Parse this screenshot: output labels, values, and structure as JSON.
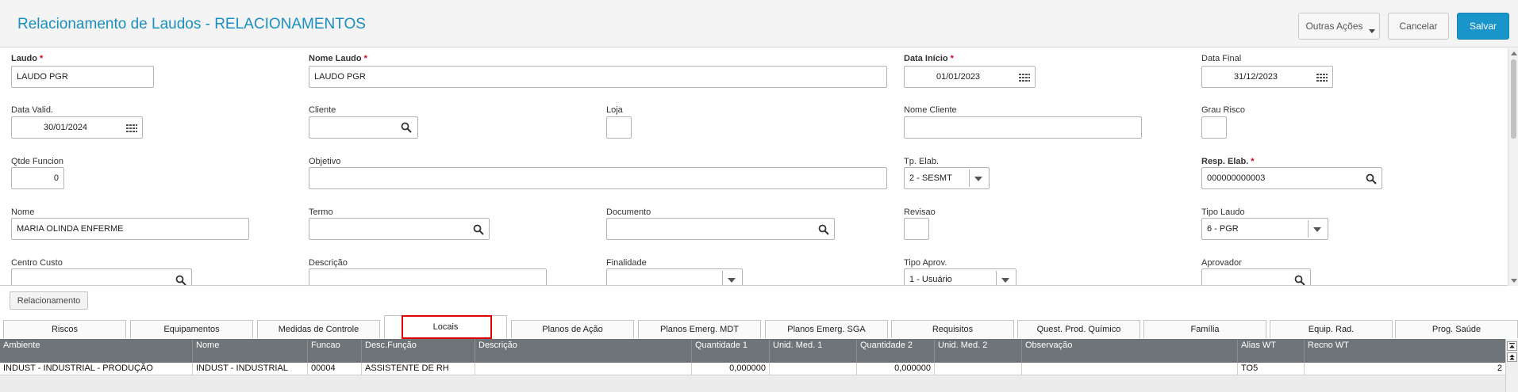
{
  "header": {
    "title": "Relacionamento de Laudos - RELACIONAMENTOS",
    "other_actions": "Outras Ações",
    "cancel": "Cancelar",
    "save": "Salvar"
  },
  "form": {
    "laudo": {
      "label": "Laudo",
      "value": "LAUDO PGR"
    },
    "nome_laudo": {
      "label": "Nome Laudo",
      "value": "LAUDO PGR"
    },
    "data_inicio": {
      "label": "Data Início",
      "value": "01/01/2023"
    },
    "data_final": {
      "label": "Data Final",
      "value": "31/12/2023"
    },
    "data_valid": {
      "label": "Data Valid.",
      "value": "30/01/2024"
    },
    "cliente": {
      "label": "Cliente",
      "value": ""
    },
    "loja": {
      "label": "Loja",
      "value": ""
    },
    "nome_cliente": {
      "label": "Nome Cliente",
      "value": ""
    },
    "grau_risco": {
      "label": "Grau Risco",
      "value": ""
    },
    "qtde_funcion": {
      "label": "Qtde Funcion",
      "value": "0"
    },
    "objetivo": {
      "label": "Objetivo",
      "value": ""
    },
    "tp_elab": {
      "label": "Tp. Elab.",
      "value": "2 - SESMT"
    },
    "resp_elab": {
      "label": "Resp. Elab.",
      "value": "000000000003"
    },
    "nome": {
      "label": "Nome",
      "value": "MARIA OLINDA ENFERME"
    },
    "termo": {
      "label": "Termo",
      "value": ""
    },
    "documento": {
      "label": "Documento",
      "value": ""
    },
    "revisao": {
      "label": "Revisao",
      "value": ""
    },
    "tipo_laudo": {
      "label": "Tipo Laudo",
      "value": "6 - PGR"
    },
    "centro_custo": {
      "label": "Centro Custo",
      "value": ""
    },
    "descricao": {
      "label": "Descrição",
      "value": ""
    },
    "finalidade": {
      "label": "Finalidade",
      "value": ""
    },
    "tipo_aprov": {
      "label": "Tipo Aprov.",
      "value": "1 - Usuário"
    },
    "aprovador": {
      "label": "Aprovador",
      "value": ""
    }
  },
  "relacionamento_button": "Relacionamento",
  "tabs": [
    "Riscos",
    "Equipamentos",
    "Medidas de Controle",
    "Locais",
    "Planos de Ação",
    "Planos Emerg. MDT",
    "Planos Emerg. SGA",
    "Requisitos",
    "Quest. Prod. Químico",
    "Família",
    "Equip. Rad.",
    "Prog. Saúde"
  ],
  "active_tab": "Locais",
  "grid": {
    "columns": [
      "Ambiente",
      "Nome",
      "Funcao",
      "Desc.Função",
      "Descrição",
      "Quantidade 1",
      "Unid. Med. 1",
      "Quantidade 2",
      "Unid. Med. 2",
      "Observação",
      "Alias WT",
      "Recno WT"
    ],
    "rows": [
      [
        "INDUST - INDUSTRIAL - PRODUÇÃO",
        "INDUST - INDUSTRIAL",
        "00004",
        "ASSISTENTE DE RH",
        "",
        "0,000000",
        "",
        "0,000000",
        "",
        "",
        "TO5",
        "2"
      ]
    ]
  }
}
